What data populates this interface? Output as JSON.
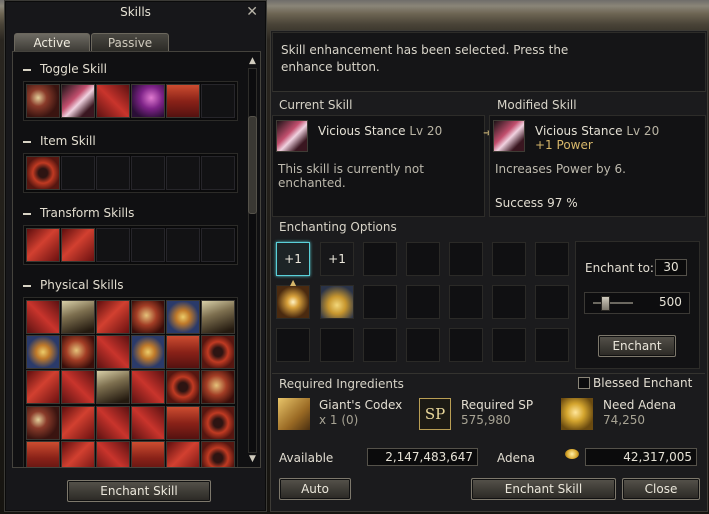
{
  "skills_window": {
    "title": "Skills",
    "tabs": [
      {
        "label": "Active"
      },
      {
        "label": "Passive"
      }
    ],
    "categories": [
      {
        "label": "Toggle Skill"
      },
      {
        "label": "Item Skill"
      },
      {
        "label": "Transform Skills"
      },
      {
        "label": "Physical Skills"
      }
    ],
    "enchant_skill_label": "Enchant Skill"
  },
  "enchant_window": {
    "message": "Skill enhancement has been selected. Press the enhance button.",
    "current": {
      "title": "Current Skill",
      "name": "Vicious Stance",
      "level": "Lv 20",
      "description": "This skill is currently not enchanted."
    },
    "modified": {
      "title": "Modified Skill",
      "name": "Vicious Stance",
      "level": "Lv 20",
      "bonus": "+1 Power",
      "description": "Increases Power by 6.",
      "success": "Success 97 %"
    },
    "options": {
      "title": "Enchanting Options",
      "slot1": "+1",
      "slot2": "+1",
      "enchant_to_label": "Enchant to:",
      "enchant_to_value": "30",
      "slider_value": "500",
      "enchant_label": "Enchant"
    },
    "ingredients": {
      "title": "Required Ingredients",
      "blessed_label": "Blessed Enchant",
      "items": [
        {
          "name": "Giant's Codex",
          "value": "x 1 (0)"
        },
        {
          "name": "Required SP",
          "value": "575,980",
          "icon_text": "SP"
        },
        {
          "name": "Need Adena",
          "value": "74,250"
        }
      ]
    },
    "available": {
      "label": "Available",
      "value": "2,147,483,647"
    },
    "adena": {
      "label": "Adena",
      "value": "42,317,005"
    },
    "buttons": {
      "auto": "Auto",
      "enchant_skill": "Enchant Skill",
      "close": "Close"
    }
  }
}
